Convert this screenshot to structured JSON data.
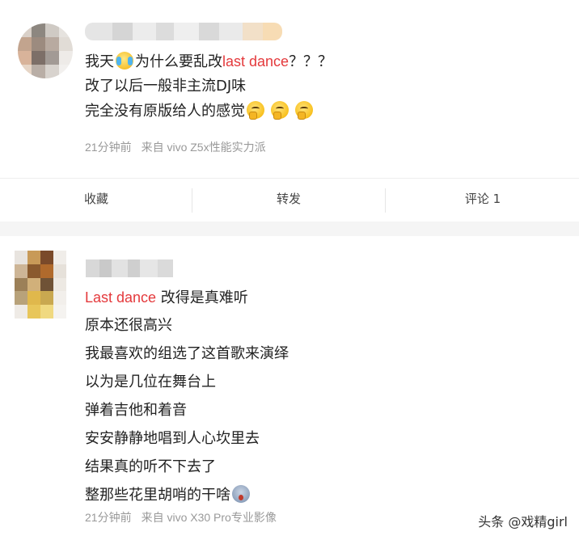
{
  "post1": {
    "content": {
      "line1_a": "我天",
      "line1_emoji": "crying-laughing-emoji",
      "line1_b": "为什么要乱改",
      "line1_hl": "last dance",
      "line1_c": "？？？",
      "line2": "改了以后一般非主流DJ味",
      "line3": "完全没有原版给人的感觉",
      "line3_emoji": "thinking-emoji"
    },
    "meta": {
      "time": "21分钟前",
      "source": "来自 vivo Z5x性能实力派"
    }
  },
  "actions": {
    "favorite": "收藏",
    "repost": "转发",
    "comment": "评论 1"
  },
  "post2": {
    "content": {
      "line1_hl": "Last dance",
      "line1_b": " 改得是真难听",
      "line2": "原本还很高兴",
      "line3": "我最喜欢的组选了这首歌来演绎",
      "line4": "以为是几位在舞台上",
      "line5": "弹着吉他和着音",
      "line6": "安安静静地唱到人心坎里去",
      "line7": "结果真的听不下去了",
      "line8": "整那些花里胡哨的干啥",
      "line8_emoji": "shocked-emoji"
    },
    "meta": {
      "time": "21分钟前",
      "source": "来自 vivo X30 Pro专业影像"
    }
  },
  "watermark": "头条 @戏精girl",
  "colors": {
    "highlight": "#e4393c",
    "meta": "#999999",
    "divider": "#eeeeee"
  }
}
